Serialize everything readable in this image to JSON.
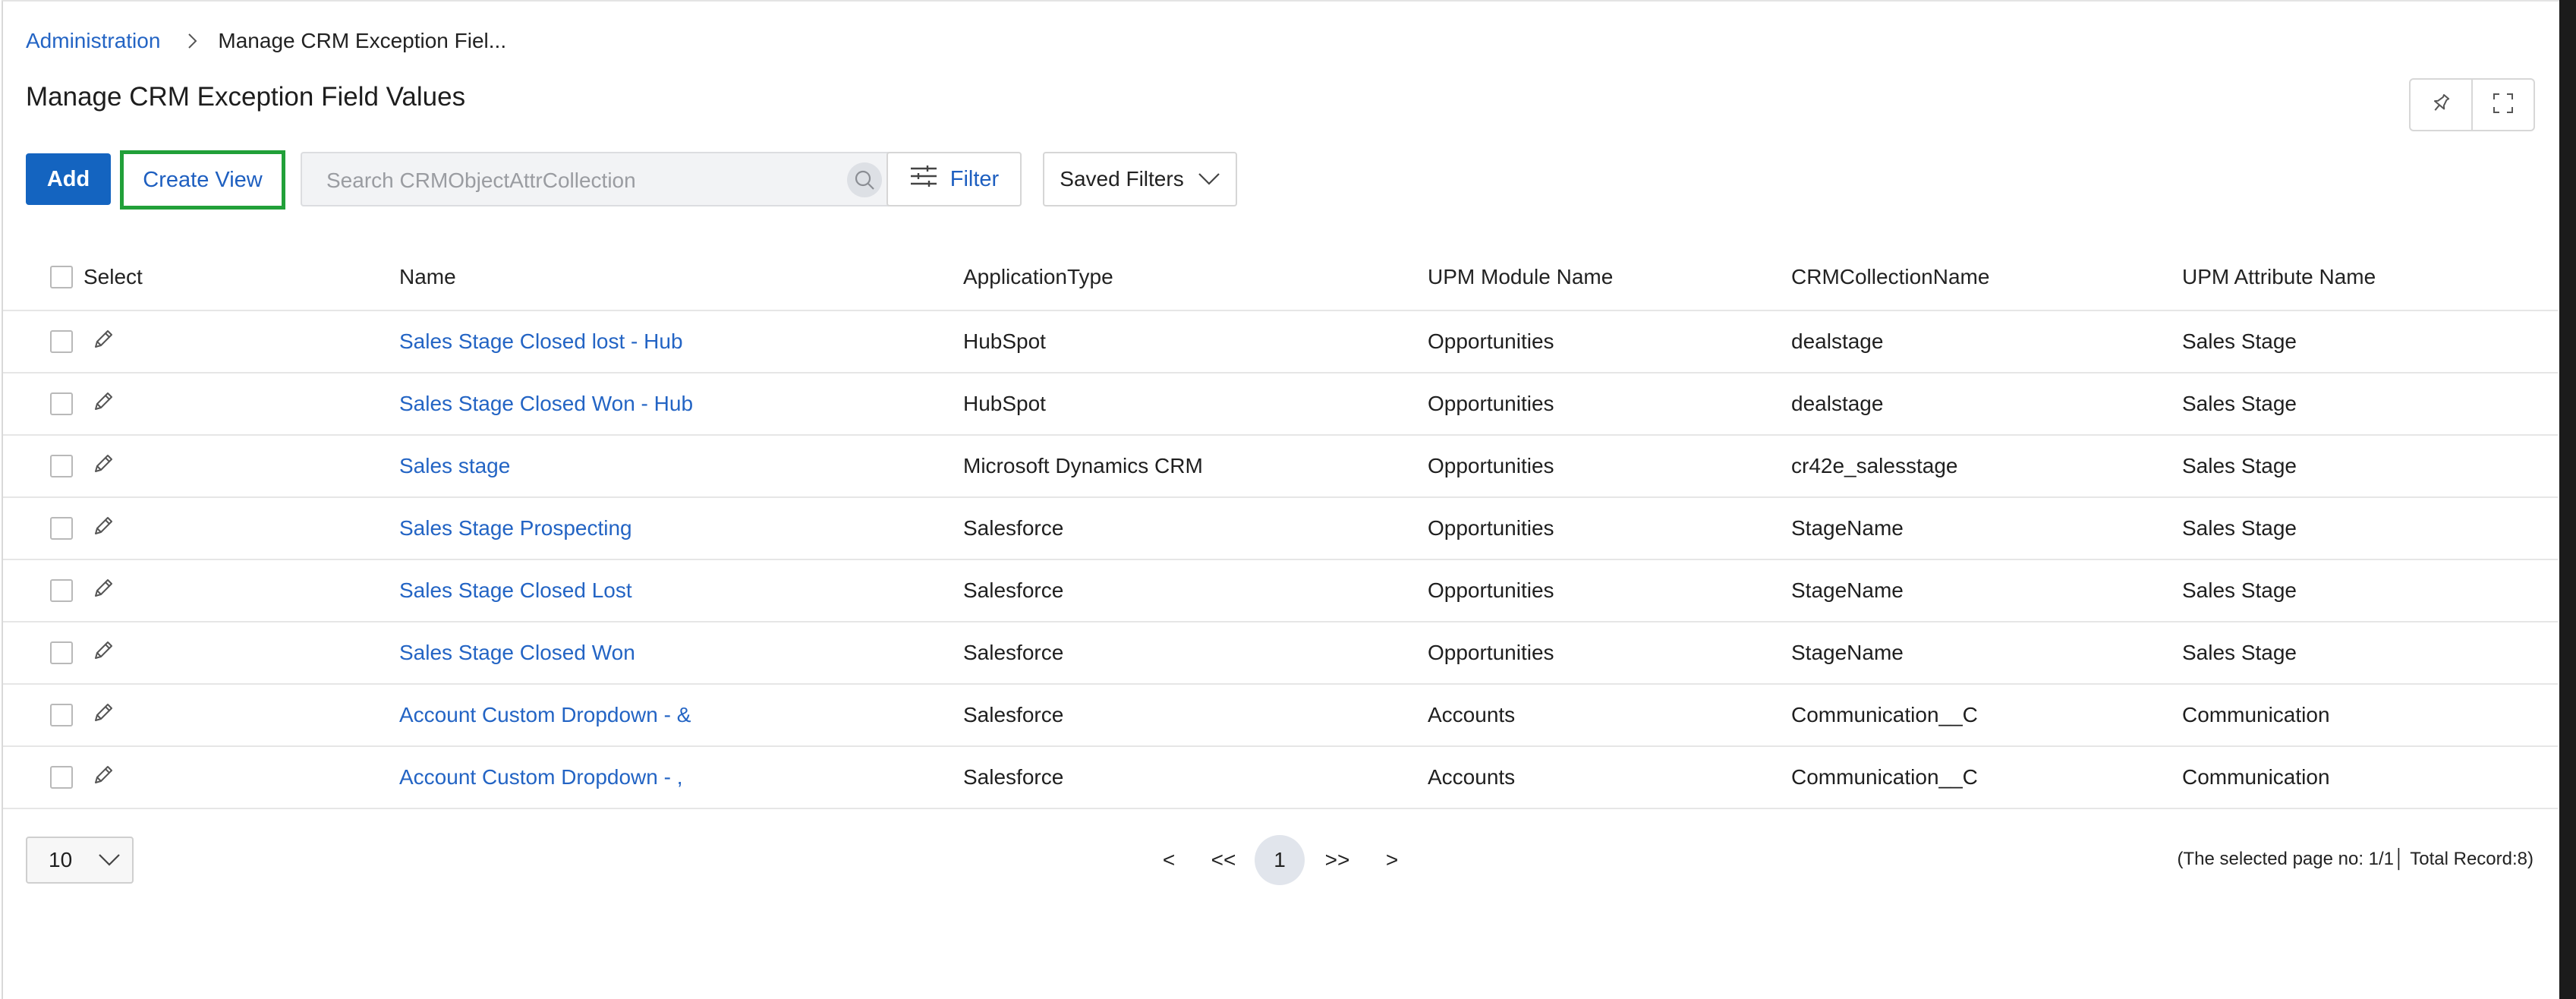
{
  "breadcrumb": {
    "root": "Administration",
    "current": "Manage CRM Exception Fiel..."
  },
  "page": {
    "title": "Manage CRM Exception Field Values"
  },
  "toolbar": {
    "add_label": "Add",
    "create_view_label": "Create View",
    "search_placeholder": "Search CRMObjectAttrCollection",
    "filter_label": "Filter",
    "saved_filters_label": "Saved Filters"
  },
  "table": {
    "columns": {
      "select": "Select",
      "name": "Name",
      "application_type": "ApplicationType",
      "module": "UPM Module Name",
      "collection": "CRMCollectionName",
      "attribute": "UPM Attribute Name"
    },
    "rows": [
      {
        "name": "Sales Stage Closed lost - Hub",
        "app": "HubSpot",
        "module": "Opportunities",
        "collection": "dealstage",
        "attribute": "Sales Stage"
      },
      {
        "name": "Sales Stage Closed Won - Hub",
        "app": "HubSpot",
        "module": "Opportunities",
        "collection": "dealstage",
        "attribute": "Sales Stage"
      },
      {
        "name": "Sales stage",
        "app": "Microsoft Dynamics CRM",
        "module": "Opportunities",
        "collection": "cr42e_salesstage",
        "attribute": "Sales Stage"
      },
      {
        "name": "Sales Stage Prospecting",
        "app": "Salesforce",
        "module": "Opportunities",
        "collection": "StageName",
        "attribute": "Sales Stage"
      },
      {
        "name": "Sales Stage Closed Lost",
        "app": "Salesforce",
        "module": "Opportunities",
        "collection": "StageName",
        "attribute": "Sales Stage"
      },
      {
        "name": "Sales Stage Closed Won",
        "app": "Salesforce",
        "module": "Opportunities",
        "collection": "StageName",
        "attribute": "Sales Stage"
      },
      {
        "name": "Account Custom Dropdown - &",
        "app": "Salesforce",
        "module": "Accounts",
        "collection": "Communication__C",
        "attribute": "Communication"
      },
      {
        "name": "Account Custom Dropdown - ,",
        "app": "Salesforce",
        "module": "Accounts",
        "collection": "Communication__C",
        "attribute": "Communication"
      }
    ]
  },
  "pagination": {
    "page_size": "10",
    "prev": "<",
    "first": "<<",
    "current_page": "1",
    "last": ">>",
    "next": ">",
    "info": "(The selected page no: 1/1│ Total Record:8)"
  },
  "colors": {
    "accent": "#1464c0",
    "link": "#2364c4",
    "highlight": "#21a039"
  },
  "icons": {
    "breadcrumb_separator": "chevron-right-icon",
    "pin": "pin-icon",
    "fullscreen": "fullscreen-icon",
    "search": "search-icon",
    "filter": "sliders-icon",
    "dropdown": "chevron-down-icon",
    "edit": "pencil-icon"
  }
}
